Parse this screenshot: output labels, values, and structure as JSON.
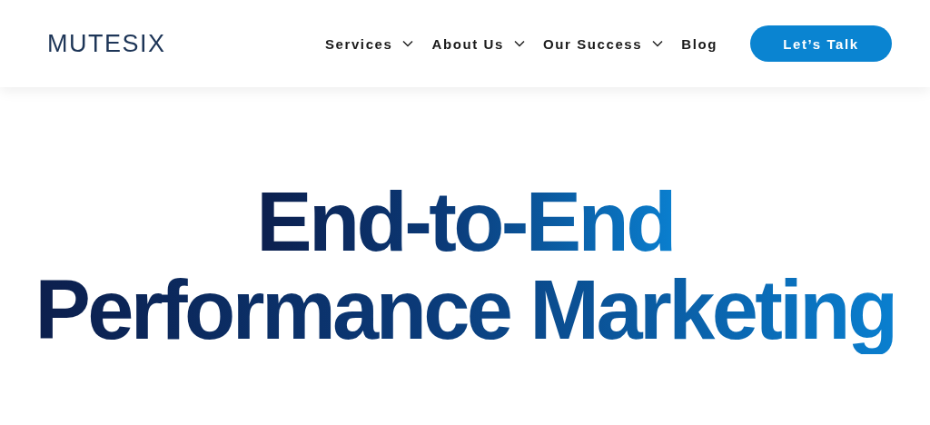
{
  "header": {
    "logo": "MUTESIX",
    "nav": [
      {
        "label": "Services",
        "has_dropdown": true
      },
      {
        "label": "About Us",
        "has_dropdown": true
      },
      {
        "label": "Our Success",
        "has_dropdown": true
      },
      {
        "label": "Blog",
        "has_dropdown": false
      }
    ],
    "cta": "Let’s Talk"
  },
  "hero": {
    "headline_lines": [
      "End-to-End",
      "Performance Marketing"
    ]
  }
}
